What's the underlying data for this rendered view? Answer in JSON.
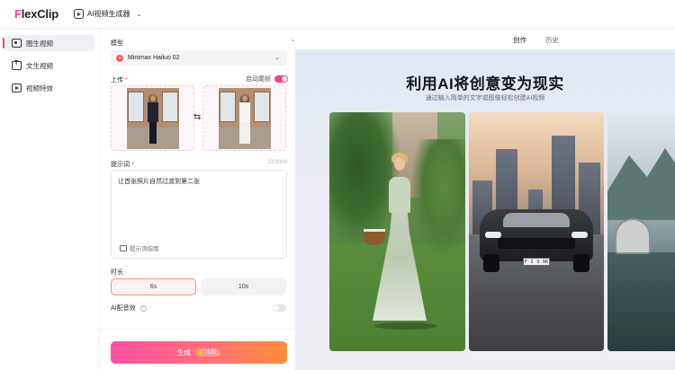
{
  "topbar": {
    "logo_first": "F",
    "logo_rest": "lexClip",
    "tool_label": "AI视频生成器"
  },
  "sidebar": {
    "items": [
      {
        "label": "图生视频",
        "icon": "image-video-icon",
        "active": true
      },
      {
        "label": "文生视频",
        "icon": "text-video-icon",
        "active": false
      },
      {
        "label": "视频特效",
        "icon": "video-effects-icon",
        "active": false
      }
    ]
  },
  "form": {
    "model_label": "模型",
    "model_value": "Minimax Hailuo 02",
    "upload_label": "上传",
    "upload_required": "*",
    "end_frame_label": "启动尾帧",
    "end_frame_on": true,
    "prompt_label": "提示词",
    "prompt_required": "*",
    "prompt_count": "13/2000",
    "prompt_value": "让首张照片自然过渡到第二张",
    "prompt_guide": "提示词指南",
    "duration_label": "时长",
    "durations": [
      "6s",
      "10s"
    ],
    "selected_duration": "6s",
    "ai_sound_label": "AI配音效",
    "ai_sound_help": "?",
    "ai_sound_on": false,
    "generate_label": "生成",
    "generate_cost": "-120"
  },
  "preview": {
    "tabs": [
      "创作",
      "历史"
    ],
    "active_tab": "创作",
    "hero_title": "利用AI将创意变为现实",
    "hero_subtitle": "通过输入简单的文字或图像轻松创建AI视频",
    "car_plate": "F·I 3 96"
  },
  "colors": {
    "accent": "#ff3d7f",
    "generate_gradient_start": "#ff4fa5",
    "generate_gradient_end": "#ff8e3c"
  }
}
